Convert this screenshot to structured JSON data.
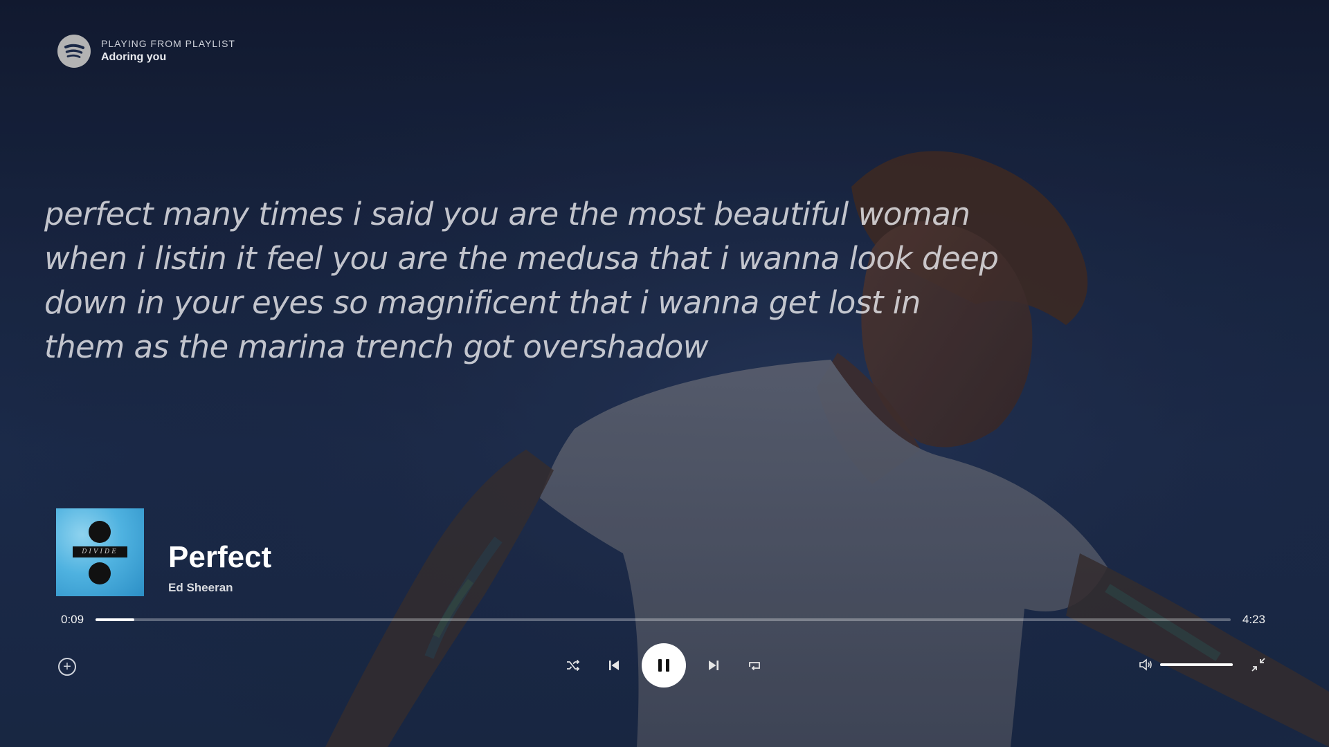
{
  "header": {
    "kicker": "PLAYING FROM PLAYLIST",
    "playlist": "Adoring you"
  },
  "lyrics": {
    "lines": [
      "perfect many times i said you are the most beautiful woman",
      "when i listin it feel you are the medusa that i wanna look deep",
      "down in your eyes so magnificent that i wanna get lost in",
      "them as the marina trench got overshadow"
    ]
  },
  "track": {
    "title": "Perfect",
    "artist": "Ed Sheeran",
    "album_cover_text": "DIVIDE"
  },
  "playback": {
    "elapsed": "0:09",
    "duration": "4:23",
    "progress_fraction": 0.034,
    "volume_fraction": 1.0
  },
  "icons": {
    "logo": "spotify-logo-icon",
    "add": "add-circle-icon",
    "shuffle": "shuffle-icon",
    "previous": "skip-previous-icon",
    "pause": "pause-icon",
    "next": "skip-next-icon",
    "repeat": "repeat-icon",
    "volume": "volume-icon",
    "exit_fullscreen": "exit-fullscreen-icon"
  },
  "colors": {
    "background": "#1b2947",
    "accent": "#ffffff",
    "muted_text": "#cfd3db"
  }
}
